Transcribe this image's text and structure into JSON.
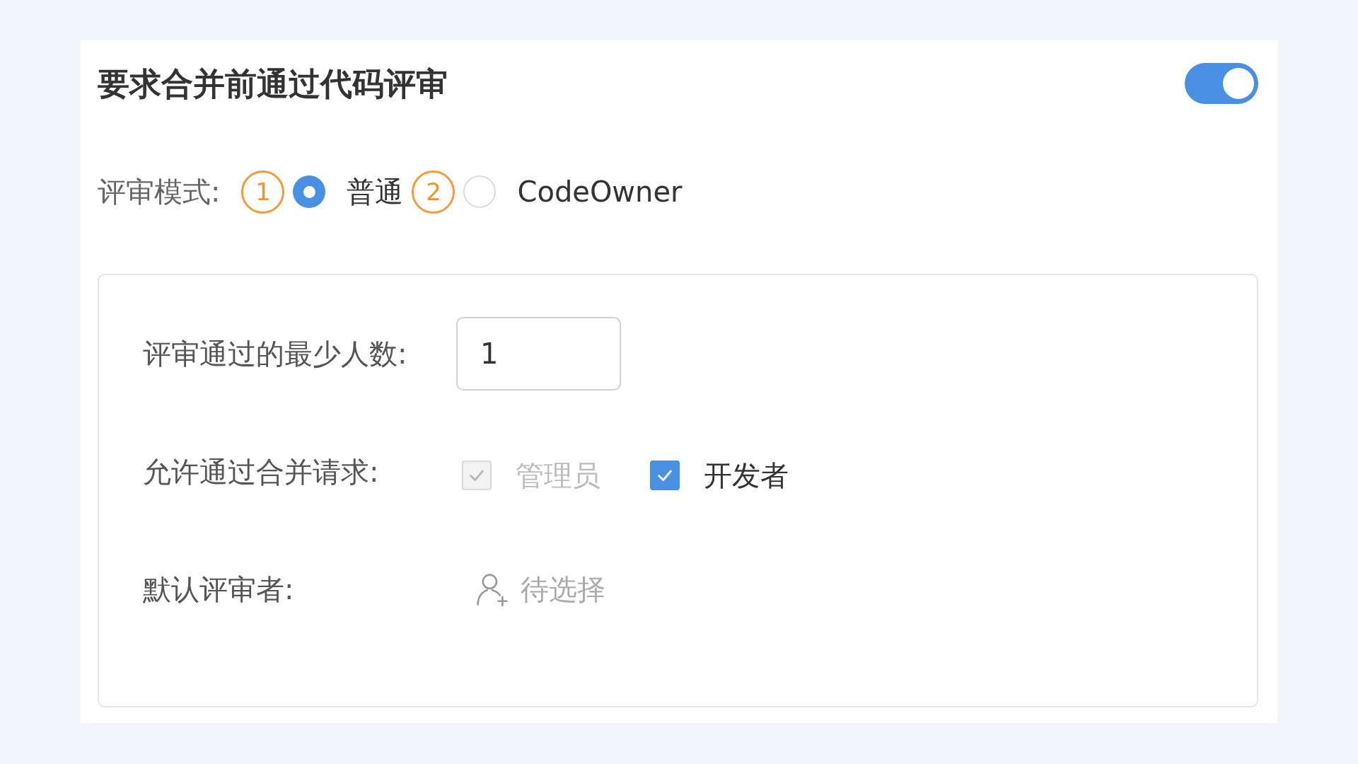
{
  "section": {
    "title": "要求合并前通过代码评审",
    "toggle": {
      "on": true
    }
  },
  "review_mode": {
    "label": "评审模式:",
    "options": [
      {
        "callout": "1",
        "label": "普通",
        "selected": true
      },
      {
        "callout": "2",
        "label": "CodeOwner",
        "selected": false
      }
    ]
  },
  "settings": {
    "min_approvals": {
      "label": "评审通过的最少人数:",
      "value": "1"
    },
    "allow_merge": {
      "label": "允许通过合并请求:",
      "options": [
        {
          "label": "管理员",
          "checked": true,
          "disabled": true
        },
        {
          "label": "开发者",
          "checked": true,
          "disabled": false
        }
      ]
    },
    "default_reviewers": {
      "label": "默认评审者:",
      "placeholder": "待选择"
    }
  }
}
